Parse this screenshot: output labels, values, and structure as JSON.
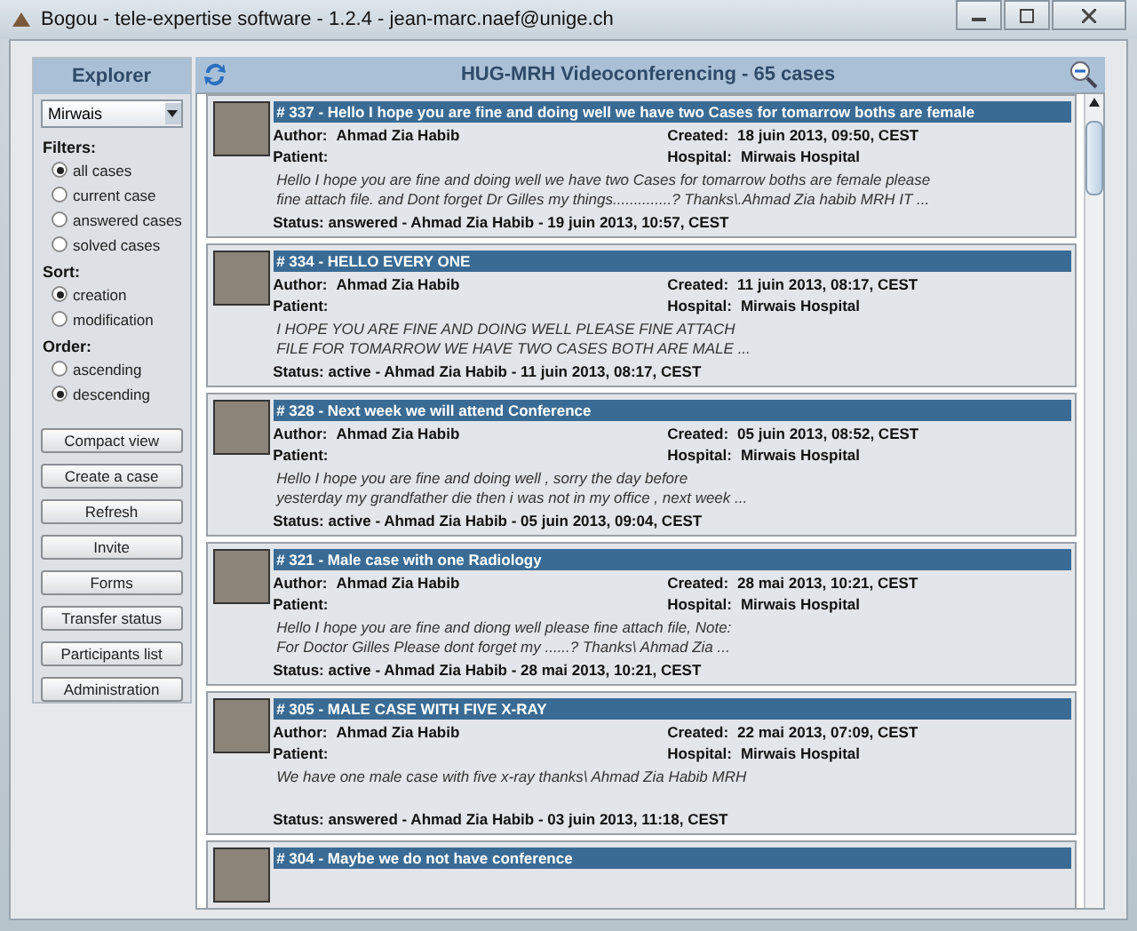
{
  "window": {
    "title": "Bogou - tele-expertise software - 1.2.4 - jean-marc.naef@unige.ch"
  },
  "explorer": {
    "title": "Explorer",
    "dropdown": {
      "value": "Mirwais"
    },
    "groups": [
      {
        "label": "Filters:",
        "options": [
          {
            "label": "all cases",
            "selected": true
          },
          {
            "label": "current case",
            "selected": false
          },
          {
            "label": "answered cases",
            "selected": false
          },
          {
            "label": "solved cases",
            "selected": false
          }
        ]
      },
      {
        "label": "Sort:",
        "options": [
          {
            "label": "creation",
            "selected": true
          },
          {
            "label": "modification",
            "selected": false
          }
        ]
      },
      {
        "label": "Order:",
        "options": [
          {
            "label": "ascending",
            "selected": false
          },
          {
            "label": "descending",
            "selected": true
          }
        ]
      }
    ],
    "buttons": [
      "Compact view",
      "Create a case",
      "Refresh",
      "Invite",
      "Forms",
      "Transfer status",
      "Participants list",
      "Administration"
    ]
  },
  "main": {
    "title": "HUG-MRH Videoconferencing - 65 cases",
    "cases": [
      {
        "title": "# 337 - Hello I hope you are fine and doing well we have two Cases for tomarrow boths are female",
        "fields": [
          {
            "label": "Author:",
            "value": "Ahmad Zia Habib"
          },
          {
            "label": "Created:",
            "value": "18 juin 2013, 09:50, CEST"
          },
          {
            "label": "Patient:"
          },
          {
            "label": "Hospital:",
            "value": "Mirwais Hospital"
          }
        ],
        "message": [
          "Hello I hope you are fine and doing well we have two Cases for tomarrow boths are female please",
          "fine attach file. and Dont forget Dr Gilles my things..............? Thanks\\.Ahmad Zia habib MRH IT  ..."
        ],
        "status": "Status: answered - Ahmad Zia Habib - 19 juin 2013, 10:57, CEST"
      },
      {
        "title": "# 334 - HELLO EVERY ONE",
        "fields": [
          {
            "label": "Author:",
            "value": "Ahmad Zia Habib"
          },
          {
            "label": "Created:",
            "value": "11 juin 2013, 08:17, CEST"
          },
          {
            "label": "Patient:"
          },
          {
            "label": "Hospital:",
            "value": "Mirwais Hospital"
          }
        ],
        "message": [
          "I HOPE YOU ARE FINE AND DOING WELL PLEASE FINE ATTACH",
          "FILE FOR TOMARROW WE HAVE TWO CASES BOTH ARE MALE  ..."
        ],
        "status": "Status: active - Ahmad Zia Habib - 11 juin 2013, 08:17, CEST"
      },
      {
        "title": "# 328 - Next week we will attend Conference",
        "fields": [
          {
            "label": "Author:",
            "value": "Ahmad Zia Habib"
          },
          {
            "label": "Created:",
            "value": "05 juin 2013, 08:52, CEST"
          },
          {
            "label": "Patient:"
          },
          {
            "label": "Hospital:",
            "value": "Mirwais Hospital"
          }
        ],
        "message": [
          "Hello I hope you are fine and doing well , sorry the day before",
          "yesterday my grandfather die then i was not in my office , next week  ..."
        ],
        "status": "Status: active - Ahmad Zia Habib - 05 juin 2013, 09:04, CEST"
      },
      {
        "title": "# 321 - Male case with one Radiology",
        "fields": [
          {
            "label": "Author:",
            "value": "Ahmad Zia Habib"
          },
          {
            "label": "Created:",
            "value": "28 mai 2013, 10:21, CEST"
          },
          {
            "label": "Patient:"
          },
          {
            "label": "Hospital:",
            "value": "Mirwais Hospital"
          }
        ],
        "message": [
          "Hello I hope you are fine and diong well please fine attach file, Note:",
          "For Doctor Gilles Please dont forget my ......? Thanks\\ Ahmad Zia  ..."
        ],
        "status": "Status: active - Ahmad Zia Habib - 28 mai 2013, 10:21, CEST"
      },
      {
        "title": "# 305 - MALE CASE WITH FIVE X-RAY",
        "fields": [
          {
            "label": "Author:",
            "value": "Ahmad Zia Habib"
          },
          {
            "label": "Created:",
            "value": "22 mai 2013, 07:09, CEST"
          },
          {
            "label": "Patient:"
          },
          {
            "label": "Hospital:",
            "value": "Mirwais Hospital"
          }
        ],
        "message": [
          "We have one male case with five x-ray thanks\\ Ahmad Zia Habib MRH"
        ],
        "status": "Status: answered - Ahmad Zia Habib - 03 juin 2013, 11:18, CEST"
      },
      {
        "title": "# 304 - Maybe we do not have conference"
      }
    ]
  }
}
